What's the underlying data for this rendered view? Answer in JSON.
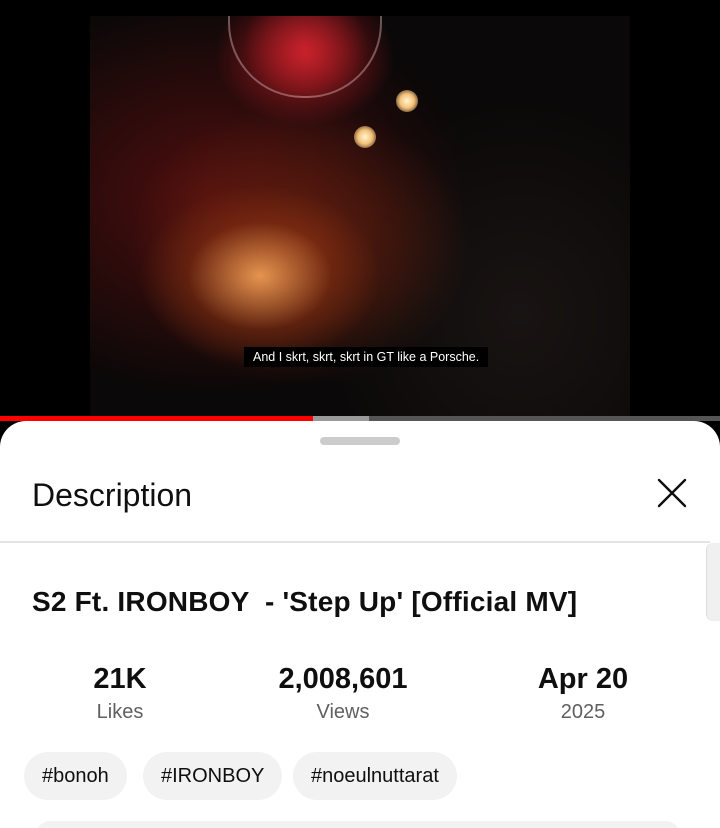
{
  "player": {
    "subtitle": "And I skrt, skrt, skrt in GT like a Porsche.",
    "progress_played_fraction": 0.435,
    "progress_buffered_fraction": 0.512
  },
  "description_panel": {
    "title": "Description",
    "close_icon": "close-icon",
    "video_title": "S2 Ft. IRONBOY  - 'Step Up' [Official MV]",
    "stats": [
      {
        "value": "21K",
        "label": "Likes"
      },
      {
        "value": "2,008,601",
        "label": "Views"
      },
      {
        "value": "Apr 20",
        "label": "2025"
      }
    ],
    "hashtags": [
      "#bonoh",
      "#IRONBOY",
      "#noeulnuttarat"
    ]
  },
  "colors": {
    "progress_played": "#ff0000",
    "progress_buffered": "#9a9a9a",
    "sheet_background": "#ffffff",
    "chip_background": "#f2f2f2",
    "text_primary": "#0f0f0f",
    "text_secondary": "#606060"
  }
}
